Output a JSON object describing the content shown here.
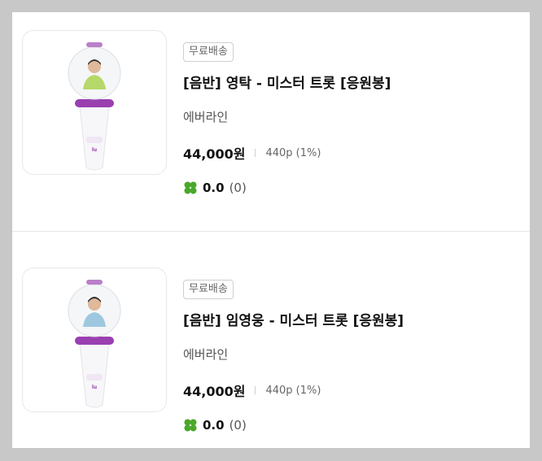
{
  "items": [
    {
      "badge": "무료배송",
      "title": "[음반] 영탁 - 미스터 트롯 [응원봉]",
      "seller": "에버라인",
      "price": "44,000원",
      "points": "440p (1%)",
      "rating": "0.0",
      "review_count": "(0)",
      "shirt_color": "#b6d86a"
    },
    {
      "badge": "무료배송",
      "title": "[음반] 임영웅 - 미스터 트롯 [응원봉]",
      "seller": "에버라인",
      "price": "44,000원",
      "points": "440p (1%)",
      "rating": "0.0",
      "review_count": "(0)",
      "shirt_color": "#9ec8e0"
    }
  ],
  "colors": {
    "accent_purple": "#9a3fb0",
    "clover_green": "#4aa82a"
  },
  "icons": {
    "product_image": "lightstick-image",
    "rating": "clover-icon"
  }
}
